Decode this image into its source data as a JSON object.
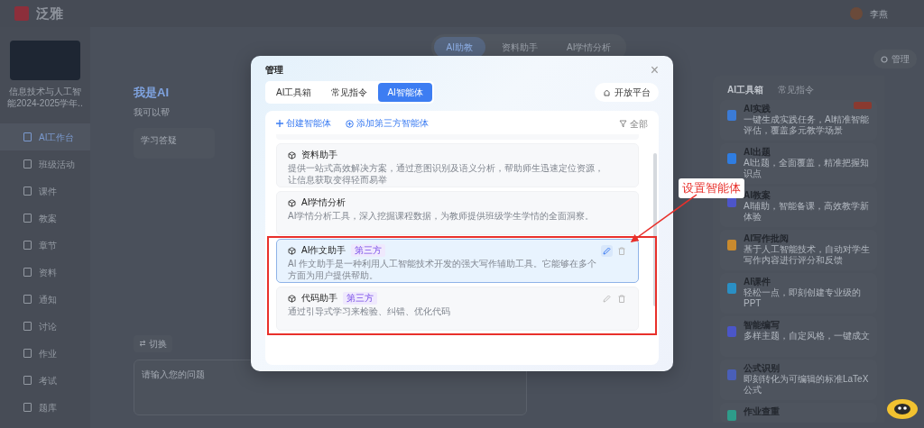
{
  "app": {
    "logo": "泛雅",
    "user": "李燕"
  },
  "course": {
    "title": "信息技术与人工智能2024-2025学年.."
  },
  "sidebar": {
    "items": [
      {
        "label": "AI工作台",
        "selected": true
      },
      {
        "label": "班级活动",
        "selected": false
      },
      {
        "label": "课件",
        "selected": false
      },
      {
        "label": "教案",
        "selected": false
      },
      {
        "label": "章节",
        "selected": false
      },
      {
        "label": "资料",
        "selected": false
      },
      {
        "label": "通知",
        "selected": false
      },
      {
        "label": "讨论",
        "selected": false
      },
      {
        "label": "作业",
        "selected": false
      },
      {
        "label": "考试",
        "selected": false
      },
      {
        "label": "题库",
        "selected": false
      }
    ]
  },
  "top_tabs": [
    {
      "label": "AI助教",
      "selected": true
    },
    {
      "label": "资料助手",
      "selected": false
    },
    {
      "label": "AI学情分析",
      "selected": false
    }
  ],
  "manage_button": "管理",
  "assistant": {
    "title": "我是AI",
    "subtitle": "我可以帮",
    "card": "学习答疑",
    "switch": "切换",
    "input_placeholder": "请输入您的问题"
  },
  "tool_panel": {
    "tabs": [
      {
        "label": "AI工具箱",
        "selected": true
      },
      {
        "label": "常见指令",
        "selected": false
      }
    ],
    "tools": [
      {
        "title": "AI实践",
        "desc": "一键生成实践任务，AI精准智能评估，覆盖多元教学场景",
        "color": "#3b7bd6",
        "badge": true
      },
      {
        "title": "AI出题",
        "desc": "AI出题，全面覆盖，精准把握知识点",
        "color": "#2f7de1",
        "badge": false
      },
      {
        "title": "AI教案",
        "desc": "AI辅助，智能备课，高效教学新体验",
        "color": "#4d55c9",
        "badge": false
      },
      {
        "title": "AI写作批阅",
        "desc": "基于人工智能技术，自动对学生写作内容进行评分和反馈",
        "color": "#c98a2e",
        "badge": false
      },
      {
        "title": "AI课件",
        "desc": "轻松一点，即刻创建专业级的PPT",
        "color": "#2a8fc4",
        "badge": false
      },
      {
        "title": "智能编写",
        "desc": "多样主题，自定风格，一键成文",
        "color": "#4b56c8",
        "badge": false
      },
      {
        "title": "公式识别",
        "desc": "即刻转化为可编辑的标准LaTeX公式",
        "color": "#4a5fb8",
        "badge": false
      },
      {
        "title": "作业查重",
        "color": "#2e9c8a",
        "badge": false
      }
    ]
  },
  "modal": {
    "title": "管理",
    "close": "×",
    "tabs": [
      {
        "label": "AI工具箱",
        "selected": false
      },
      {
        "label": "常见指令",
        "selected": false
      },
      {
        "label": "AI智能体",
        "selected": true
      }
    ],
    "open_platform": "开放平台",
    "create": "创建智能体",
    "add_third_party": "添加第三方智能体",
    "filter": "全部",
    "agents": [
      {
        "name": "资料助手",
        "desc": "提供一站式高效解决方案，通过意图识别及语义分析，帮助师生迅速定位资源，让信息获取变得轻而易举",
        "editable": false,
        "selected": false
      },
      {
        "name": "AI学情分析",
        "desc": "AI学情分析工具，深入挖掘课程数据，为教师提供班级学生学情的全面洞察。",
        "editable": false,
        "selected": false
      },
      {
        "name": "AI作文助手",
        "desc": "AI 作文助手是一种利用人工智能技术开发的强大写作辅助工具。它能够在多个方面为用户提供帮助。",
        "tag": "第三方",
        "editable": true,
        "selected": true
      },
      {
        "name": "代码助手",
        "desc": "通过引导式学习来检验、纠错、优化代码",
        "tag": "第三方",
        "editable": true,
        "selected": false
      }
    ]
  },
  "annotation": {
    "label": "设置智能体"
  }
}
